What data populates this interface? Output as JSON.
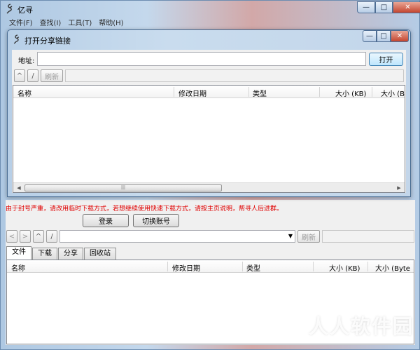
{
  "main_window": {
    "title": "亿寻",
    "caption_buttons": {
      "minimize": "—",
      "maximize": "□",
      "close": "✕"
    }
  },
  "menu": [
    "文件(F)",
    "查找(I)",
    "工具(T)",
    "帮助(H)"
  ],
  "dialog": {
    "title": "打开分享链接",
    "caption_buttons": {
      "minimize": "—",
      "maximize": "□",
      "close": "✕"
    },
    "address_label": "地址:",
    "address_value": "",
    "open_button": "打开",
    "nav_up": "^",
    "nav_root": "/",
    "refresh": "刷新",
    "columns": [
      "名称",
      "修改日期",
      "类型",
      "大小 (KB)",
      "大小 (B"
    ],
    "scroll_thumb_grip": "|||"
  },
  "notice": "由于封号严重，请改用临时下载方式，若想继续使用快速下载方式，请按主页说明，帮寻人后进群。",
  "login_button": "登录",
  "switch_account_button": "切换账号",
  "toolbar": {
    "back": "<",
    "forward": ">",
    "up": "^",
    "root": "/",
    "refresh": "刷新"
  },
  "tabs": [
    "文件",
    "下载",
    "分享",
    "回收站"
  ],
  "list_columns": [
    "名称",
    "修改日期",
    "类型",
    "大小 (KB)",
    "大小 (Byte"
  ],
  "watermark": "人人软件园"
}
